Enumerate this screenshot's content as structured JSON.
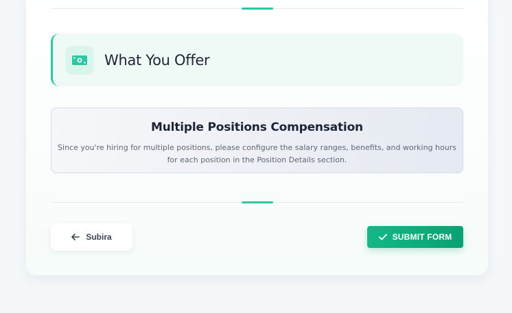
{
  "section": {
    "title": "What You Offer",
    "icon": "money-bill-icon"
  },
  "info": {
    "title": "Multiple Positions Compensation",
    "description": "Since you're hiring for multiple positions, please configure the salary ranges, benefits, and working hours for each position in the Position Details section."
  },
  "buttons": {
    "back_label": "Subira",
    "submit_label": "SUBMIT FORM"
  },
  "colors": {
    "accent": "#2cc6a4",
    "primary_button": "#12b886",
    "title_text": "#1c2436"
  }
}
